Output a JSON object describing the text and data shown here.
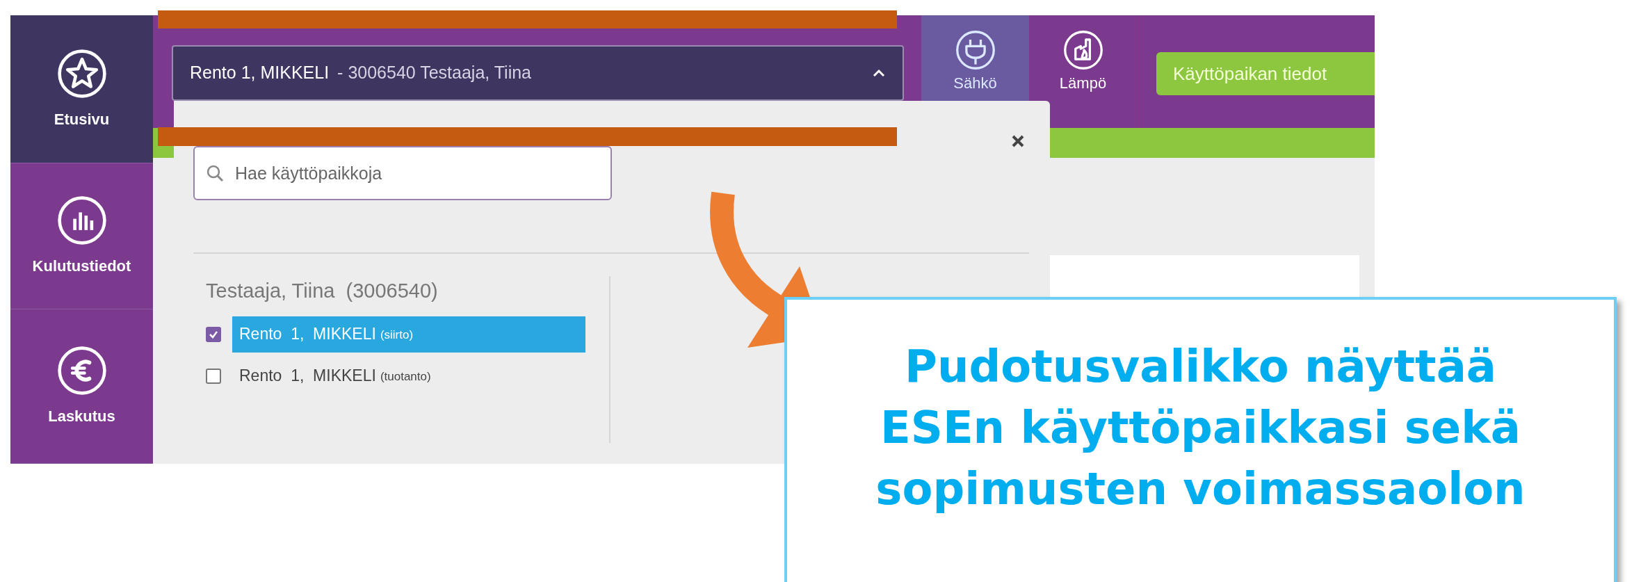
{
  "sidebar": {
    "items": [
      {
        "label": "Etusivu",
        "kind": "star",
        "selected": true
      },
      {
        "label": "Kulutustiedot",
        "kind": "chart",
        "selected": false
      },
      {
        "label": "Laskutus",
        "kind": "euro",
        "selected": false
      }
    ]
  },
  "location_selector": {
    "value": "Rento 1, MIKKELI",
    "detail": "- 3006540 Testaaja, Tiina",
    "expanded": true
  },
  "energy_tabs": [
    {
      "label": "Sähkö",
      "kind": "plug",
      "selected": true
    },
    {
      "label": "Lämpö",
      "kind": "factory",
      "selected": false
    }
  ],
  "details_button": "Käyttöpaikan tiedot",
  "dropdown": {
    "search": {
      "placeholder": "Hae käyttöpaikkoja"
    },
    "groups": [
      {
        "heading": "Testaaja, Tiina  (3006540)",
        "items": [
          {
            "name": "Rento  1,  MIKKELI",
            "type": "(siirto)",
            "checked": true,
            "selected": true
          },
          {
            "name": "Rento  1,  MIKKELI",
            "type": "(tuotanto)",
            "checked": false,
            "selected": false
          }
        ]
      }
    ]
  },
  "callout": {
    "lines": [
      "Pudotusvalikko näyttää",
      "ESEn käyttöpaikkasi sekä",
      "sopimusten voimassaolon"
    ]
  }
}
